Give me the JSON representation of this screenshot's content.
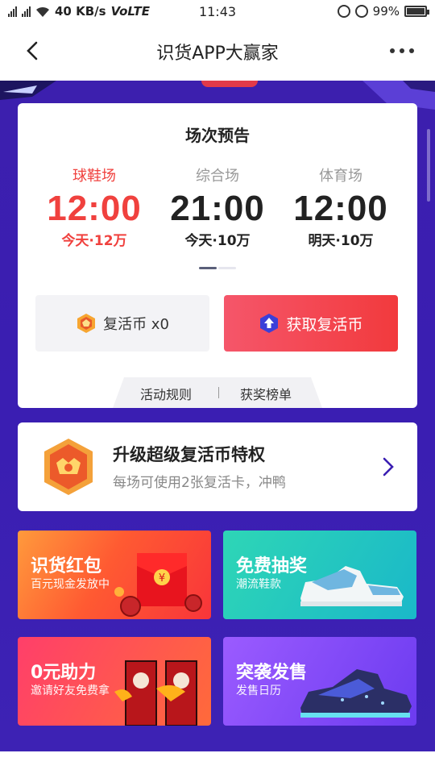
{
  "status": {
    "net1": "3G",
    "net2": "4G",
    "speed": "40 KB/s",
    "volte": "VoLTE",
    "time": "11:43",
    "battery": "99%",
    "battery_level": 0.99
  },
  "nav": {
    "title": "识货APP大赢家"
  },
  "preview": {
    "title": "场次预告",
    "sessions": [
      {
        "name": "球鞋场",
        "time": "12:00",
        "meta": "今天·12万",
        "active": true
      },
      {
        "name": "综合场",
        "time": "21:00",
        "meta": "今天·10万",
        "active": false
      },
      {
        "name": "体育场",
        "time": "12:00",
        "meta": "明天·10万",
        "active": false
      }
    ],
    "coins_label": "复活币 x0",
    "get_coins_label": "获取复活币",
    "tab_rules": "活动规则",
    "tab_winners": "获奖榜单"
  },
  "upgrade": {
    "title": "升级超级复活币特权",
    "subtitle": "每场可使用2张复活卡，冲鸭"
  },
  "tiles": [
    {
      "title": "识货红包",
      "subtitle": "百元现金发放中"
    },
    {
      "title": "免费抽奖",
      "subtitle": "潮流鞋款"
    },
    {
      "title": "0元助力",
      "subtitle": "邀请好友免费拿"
    },
    {
      "title": "突袭发售",
      "subtitle": "发售日历"
    }
  ],
  "colors": {
    "accent_red": "#f0413e",
    "stage_purple": "#3a1eb2"
  }
}
